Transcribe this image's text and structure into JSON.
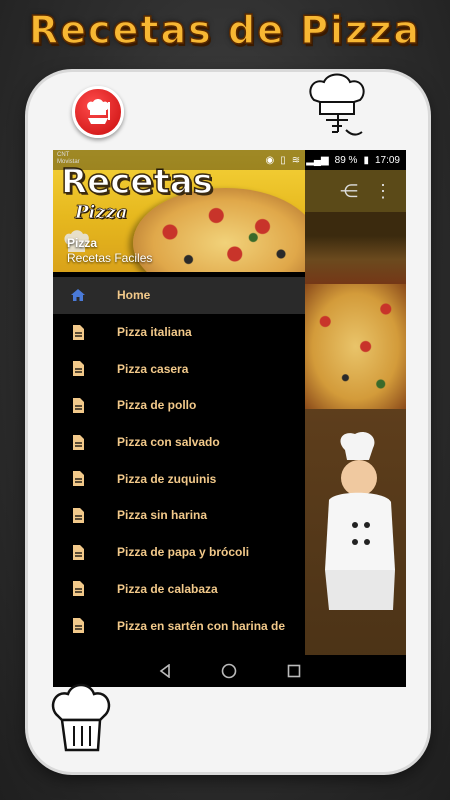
{
  "banner": {
    "title": "Recetas de Pizza"
  },
  "colors": {
    "accent": "#f2c98a",
    "header_yellow": "#f5d33a",
    "logo_red": "#e02020"
  },
  "status_bar": {
    "carrier_line1": "CNT",
    "carrier_line2": "Movistar",
    "battery": "89 %",
    "time": "17:09"
  },
  "drawer_header": {
    "title": "Recetas",
    "subtitle": "Pizza",
    "app_name": "Pizza",
    "app_desc": "Recetas Faciles"
  },
  "menu": {
    "items": [
      {
        "label": "Home",
        "icon": "home-icon",
        "active": true
      },
      {
        "label": "Pizza italiana",
        "icon": "document-icon"
      },
      {
        "label": "Pizza casera",
        "icon": "document-icon"
      },
      {
        "label": "Pizza de pollo",
        "icon": "document-icon"
      },
      {
        "label": "Pizza con salvado",
        "icon": "document-icon"
      },
      {
        "label": "Pizza de zuquinis",
        "icon": "document-icon"
      },
      {
        "label": "Pizza sin harina",
        "icon": "document-icon"
      },
      {
        "label": "Pizza de papa y brócoli",
        "icon": "document-icon"
      },
      {
        "label": "Pizza de calabaza",
        "icon": "document-icon"
      },
      {
        "label": "Pizza en sartén con harina de",
        "icon": "document-icon"
      }
    ]
  },
  "toolbar": {
    "share_icon": "share-icon",
    "more_icon": "more-vert-icon"
  },
  "navbar": {
    "back": "back-icon",
    "home": "home-circle-icon",
    "recents": "recents-icon"
  }
}
